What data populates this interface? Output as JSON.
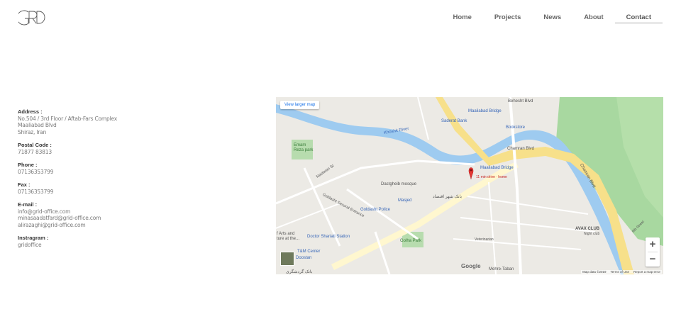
{
  "logo": {
    "text": "GRD"
  },
  "nav": {
    "items": [
      {
        "label": "Home"
      },
      {
        "label": "Projects"
      },
      {
        "label": "News"
      },
      {
        "label": "About"
      },
      {
        "label": "Contact"
      }
    ]
  },
  "contact": {
    "address_label": "Address :",
    "address_lines": [
      "No.504 / 3rd Floor / Aftab-Fars Complex",
      "Maaliabad Blvd",
      "Shiraz, Iran"
    ],
    "postal_label": "Postal Code :",
    "postal_value": "71877 83813",
    "phone_label": "Phone :",
    "phone_value": "07136353799",
    "fax_label": "Fax :",
    "fax_value": "07136353799",
    "email_label": "E-mail :",
    "email_lines": [
      "info@grid-office.com",
      "minasaadatfard@grid-office.com",
      "alirazaghi@grid-office.com"
    ],
    "instagram_label": "Instragram :",
    "instagram_value": "gridoffice"
  },
  "map": {
    "view_larger": "View larger map",
    "zoom_in": "+",
    "zoom_out": "−",
    "google": "Google",
    "map_data": "Map data ©2019",
    "terms": "Terms of Use",
    "report": "Report a map error",
    "labels": {
      "maaliabad_bridge": "Maaliabad Bridge",
      "sadorat_bank": "Saderat Bank",
      "behesht_blvd": "Behesht Blvd",
      "bookstore": "Bookstore",
      "khoshk_river": "Khoshk River",
      "chamran_blvd": "Chamran Blvd",
      "chamran_blvd2": "Chamran Blvd",
      "emam_reza_park": "Emam Reza park",
      "maaliabad_bridge2": "Maaliabad Bridge",
      "drive": "11 min drive · home",
      "dastgheib": "Dastgheib mosque",
      "bank_shahr": "بانک شهر اقتصاد",
      "masjed": "Masjed",
      "goldasht_police": "Goldasht Police",
      "goldasht_second": "Goldasht Second Entrance",
      "nastaran": "Nastaran St",
      "shariati": "Doctor Shariati Station",
      "golha_park": "Golha Park",
      "tm_center": "T&M Center",
      "doostan": "Doostan",
      "avax": "AVAX CLUB",
      "avax_sub": "Night club",
      "veterinarian": "Veterinarian",
      "mehre_taban": "Mehre-Taban",
      "arts": "f Arts and ture at the...",
      "bank_bottom": "بانک گردشگری",
      "azadi": "8th Street"
    }
  }
}
